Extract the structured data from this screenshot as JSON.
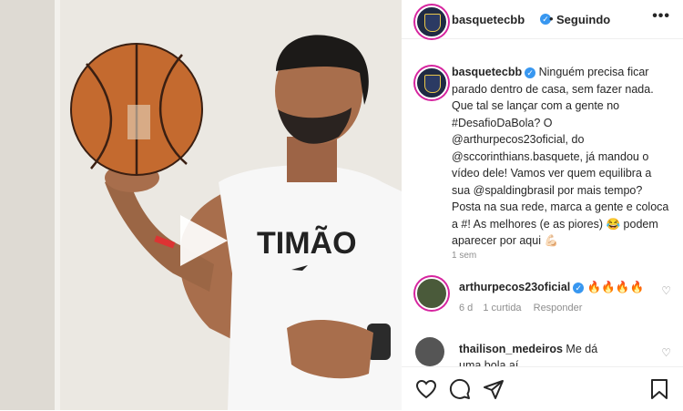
{
  "post": {
    "username": "basquetecbb",
    "follow_status": "Seguindo",
    "more_label": "•••"
  },
  "caption": {
    "username": "basquetecbb",
    "body": "Ninguém precisa ficar parado dentro de casa, sem fazer nada. Que tal se lançar com a gente no #DesafioDaBola? O @arthurpecos23oficial, do @sccorinthians.basquete, já mandou o vídeo dele! Vamos ver quem equilibra a sua @spaldingbrasil por mais tempo? Posta na sua rede, marca a gente e coloca a #! As melhores (e as piores) 😂 podem aparecer por aqui 💪🏻",
    "time": "1 sem"
  },
  "comments": [
    {
      "username": "arthurpecos23oficial",
      "text": "🔥🔥🔥🔥",
      "time": "6 d",
      "likes": "1 curtida",
      "reply_label": "Responder"
    },
    {
      "username": "thailison_medeiros",
      "text": "Me dá uma bola aí"
    }
  ],
  "shirt_text": "TIMÃO",
  "colors": {
    "link": "#00376b",
    "verified": "#3897f0",
    "story_ring": "#d6249f"
  }
}
